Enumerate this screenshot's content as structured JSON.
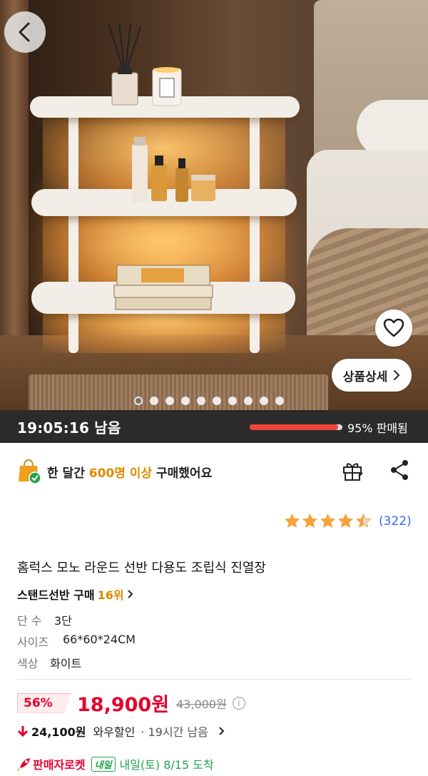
{
  "timer": {
    "remaining": "19:05:16 남음",
    "sold_percent": 95,
    "sold_label": "95% 판매됨"
  },
  "hero": {
    "detail_button": "상품상세",
    "page_count": 10,
    "active_page": 1
  },
  "purchase_notice": {
    "prefix": "한 달간 ",
    "highlight": "600명 이상",
    "suffix": " 구매했어요"
  },
  "rating": {
    "stars": 4.5,
    "review_count": "(322)"
  },
  "product": {
    "title": "홈럭스 모노 라운드 선반 다용도 조립식 진열장",
    "rank_prefix": "스탠드선반 구매 ",
    "rank_value": "16위"
  },
  "options": [
    {
      "label": "단 수",
      "value": "3단"
    },
    {
      "label": "사이즈",
      "value": "66*60*24CM"
    },
    {
      "label": "색상",
      "value": "화이트"
    }
  ],
  "price": {
    "discount": "56%",
    "sale_price": "18,900원",
    "original_price": "43,000원",
    "info_icon": "i"
  },
  "wow": {
    "price": "24,100원",
    "label": "와우할인",
    "remaining": "· 19시간 남음"
  },
  "delivery": {
    "label": "판매자로켓",
    "badge": "내일",
    "arrival": "내일(토) 8/15 도착"
  },
  "colors": {
    "accent_red": "#e5002b",
    "highlight_orange": "#e08a00",
    "link_blue": "#346aff",
    "delivery_green": "#1fa34d",
    "star": "#f7a23b"
  }
}
